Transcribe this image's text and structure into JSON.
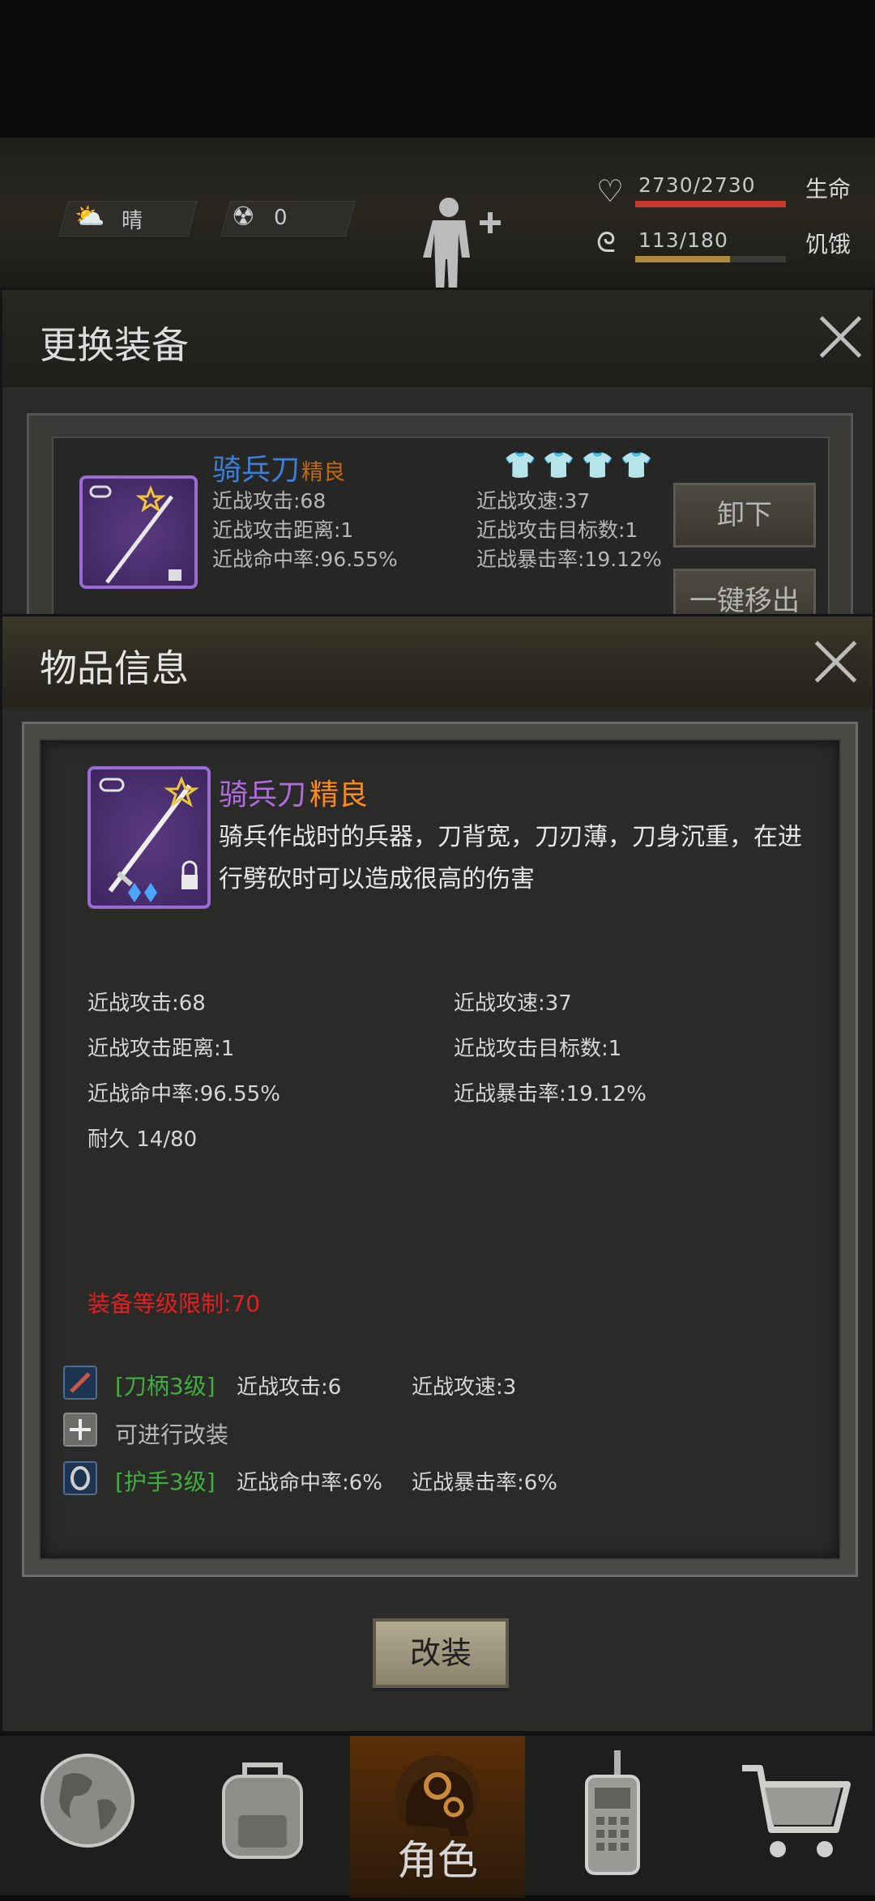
{
  "status": {
    "weather": "晴",
    "radiation": "0",
    "health_value": "2730/2730",
    "health_label": "生命",
    "health_fill": 1.0,
    "hunger_value": "113/180",
    "hunger_label": "饥饿",
    "hunger_fill": 0.63
  },
  "equip_panel": {
    "title": "更换装备",
    "item_name": "骑兵刀",
    "item_quality": "精良",
    "stats_left": [
      "近战攻击:68",
      "近战攻击距离:1",
      "近战命中率:96.55%"
    ],
    "stats_right": [
      "近战攻速:37",
      "近战攻击目标数:1",
      "近战暴击率:19.12%"
    ],
    "unequip_button": "卸下",
    "remove_all_button": "一键移出"
  },
  "item_info": {
    "title": "物品信息",
    "name": "骑兵刀",
    "quality": "精良",
    "description": "骑兵作战时的兵器，刀背宽，刀刃薄，刀身沉重，在进行劈砍时可以造成很高的伤害",
    "stats_left": [
      "近战攻击:68",
      "近战攻击距离:1",
      "近战命中率:96.55%",
      "耐久 14/80"
    ],
    "stats_right": [
      "近战攻速:37",
      "近战攻击目标数:1",
      "近战暴击率:19.12%"
    ],
    "level_requirement": "装备等级限制:70",
    "mods": [
      {
        "label": "[刀柄3级]",
        "stat1": "近战攻击:6",
        "stat2": "近战攻速:3"
      },
      {
        "label": "[护手3级]",
        "stat1": "近战命中率:6%",
        "stat2": "近战暴击率:6%"
      }
    ],
    "mod_available": "可进行改装",
    "modify_button": "改装"
  },
  "nav": {
    "role_label": "角色"
  },
  "colors": {
    "quality_orange": "#ff8a1c",
    "item_purple": "#b06be0",
    "mod_green": "#3fae3f",
    "warning_red": "#e02020"
  }
}
